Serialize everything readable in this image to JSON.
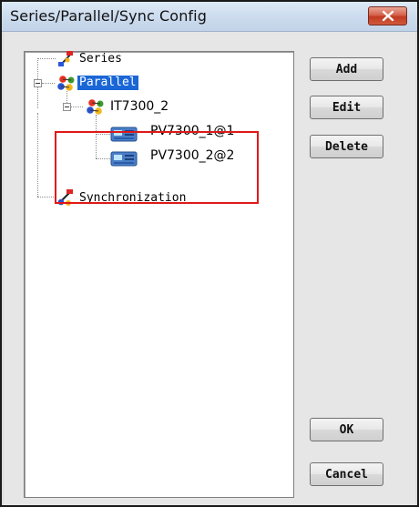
{
  "window": {
    "title": "Series/Parallel/Sync Config",
    "close_icon": "close-x-icon"
  },
  "tree": {
    "nodes": [
      {
        "label": "Series",
        "icon": "series-config-icon",
        "level": 0
      },
      {
        "label": "Parallel",
        "icon": "parallel-config-icon",
        "level": 0,
        "expanded": true,
        "selected": true
      },
      {
        "label": "IT7300_2",
        "icon": "parallel-group-icon",
        "level": 1,
        "expanded": true
      },
      {
        "label": "PV7300_1@1",
        "icon": "instrument-icon",
        "level": 2
      },
      {
        "label": "PV7300_2@2",
        "icon": "instrument-icon",
        "level": 2
      },
      {
        "label": "Synchronization",
        "icon": "sync-config-icon",
        "level": 0
      }
    ]
  },
  "buttons": {
    "add": "Add",
    "edit": "Edit",
    "delete": "Delete",
    "ok": "OK",
    "cancel": "Cancel"
  },
  "colors": {
    "selection": "#1a66d6",
    "highlight_box": "#e01818",
    "close_button": "#c23a20"
  }
}
